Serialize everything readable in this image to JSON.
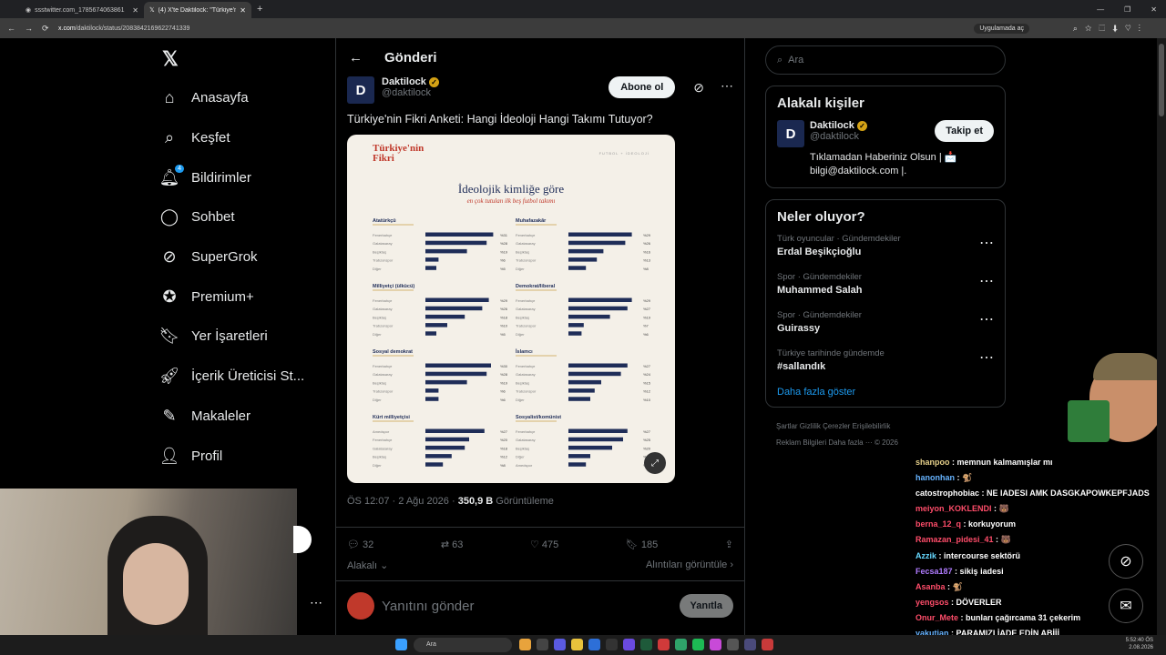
{
  "browser": {
    "tabs": [
      {
        "label": "ssstwitter.com_1785674063861"
      },
      {
        "label": "(4) X'te Daktilock: \"Türkiye'nin F"
      }
    ],
    "url_host": "x.com",
    "url_path": "/daktilock/status/2083842169622741339",
    "open_app": "Uygulamada aç"
  },
  "nav": {
    "items": [
      {
        "label": "Anasayfa",
        "icon": "home-icon"
      },
      {
        "label": "Keşfet",
        "icon": "search-icon"
      },
      {
        "label": "Bildirimler",
        "icon": "bell-icon",
        "badge": "4"
      },
      {
        "label": "Sohbet",
        "icon": "chat-icon"
      },
      {
        "label": "SuperGrok",
        "icon": "grok-icon"
      },
      {
        "label": "Premium+",
        "icon": "premium-icon"
      },
      {
        "label": "Yer İşaretleri",
        "icon": "bookmark-icon"
      },
      {
        "label": "İçerik Üreticisi St...",
        "icon": "rocket-icon"
      },
      {
        "label": "Makaleler",
        "icon": "article-icon"
      },
      {
        "label": "Profil",
        "icon": "person-icon"
      }
    ]
  },
  "post": {
    "header": "Gönderi",
    "author_name": "Daktilock",
    "author_handle": "@daktilock",
    "subscribe": "Abone ol",
    "text": "Türkiye'nin Fikri Anketi: Hangi İdeoloji Hangi Takımı Tutuyor?",
    "time": "ÖS 12:07 · 2 Ağu 2026 · ",
    "views": "350,9 B",
    "views_label": " Görüntüleme",
    "replies": "32",
    "reposts": "63",
    "likes": "475",
    "bookmarks": "185",
    "related": "Alakalı",
    "quotes": "Alıntıları görüntüle",
    "reply_placeholder": "Yanıtını gönder",
    "reply_button": "Yanıtla"
  },
  "infographic": {
    "brand_line1": "Türkiye'nin",
    "brand_line2": "Fikri",
    "top_right": "FUTBOL + İDEOLOJİ",
    "title": "İdeolojik kimliğe göre",
    "subtitle": "en çok tutulan ilk beş futbol takımı",
    "groups": [
      {
        "name": "Atatürkçü",
        "rows": [
          [
            "Fenerbahçe",
            31
          ],
          [
            "Galatasaray",
            28
          ],
          [
            "Beşiktaş",
            19
          ],
          [
            "Trabzonspor",
            6
          ],
          [
            "Diğer",
            5
          ]
        ]
      },
      {
        "name": "Muhafazakâr",
        "rows": [
          [
            "Fenerbahçe",
            29
          ],
          [
            "Galatasaray",
            26
          ],
          [
            "Beşiktaş",
            16
          ],
          [
            "Trabzonspor",
            13
          ],
          [
            "Diğer",
            8
          ]
        ]
      },
      {
        "name": "Milliyetçi (ülkücü)",
        "rows": [
          [
            "Fenerbahçe",
            29
          ],
          [
            "Galatasaray",
            26
          ],
          [
            "Beşiktaş",
            18
          ],
          [
            "Trabzonspor",
            10
          ],
          [
            "Diğer",
            5
          ]
        ]
      },
      {
        "name": "Demokrat/liberal",
        "rows": [
          [
            "Fenerbahçe",
            29
          ],
          [
            "Galatasaray",
            27
          ],
          [
            "Beşiktaş",
            19
          ],
          [
            "Trabzonspor",
            7
          ],
          [
            "Diğer",
            6
          ]
        ]
      },
      {
        "name": "Sosyal demokrat",
        "rows": [
          [
            "Fenerbahçe",
            30
          ],
          [
            "Galatasaray",
            28
          ],
          [
            "Beşiktaş",
            19
          ],
          [
            "Trabzonspor",
            6
          ],
          [
            "Diğer",
            6
          ]
        ]
      },
      {
        "name": "İslamcı",
        "rows": [
          [
            "Fenerbahçe",
            27
          ],
          [
            "Galatasaray",
            24
          ],
          [
            "Beşiktaş",
            15
          ],
          [
            "Trabzonspor",
            12
          ],
          [
            "Diğer",
            10
          ]
        ]
      },
      {
        "name": "Kürt milliyetçisi",
        "rows": [
          [
            "Amedspor",
            27
          ],
          [
            "Fenerbahçe",
            20
          ],
          [
            "Galatasaray",
            18
          ],
          [
            "Beşiktaş",
            12
          ],
          [
            "Diğer",
            8
          ]
        ]
      },
      {
        "name": "Sosyalist/komünist",
        "rows": [
          [
            "Fenerbahçe",
            27
          ],
          [
            "Galatasaray",
            25
          ],
          [
            "Beşiktaş",
            20
          ],
          [
            "Diğer",
            10
          ],
          [
            "Amedspor",
            8
          ]
        ]
      }
    ]
  },
  "sidebar": {
    "search_placeholder": "Ara",
    "people_title": "Alakalı kişiler",
    "person": {
      "name": "Daktilock",
      "handle": "@daktilock",
      "follow": "Takip et",
      "bio": "Tıklamadan Haberiniz Olsun | 📩 bilgi@daktilock.com |."
    },
    "trends_title": "Neler oluyor?",
    "trends": [
      {
        "cat": "Türk oyuncular · Gündemdekiler",
        "title": "Erdal Beşikçioğlu"
      },
      {
        "cat": "Spor · Gündemdekiler",
        "title": "Muhammed Salah"
      },
      {
        "cat": "Spor · Gündemdekiler",
        "title": "Guirassy"
      },
      {
        "cat": "Türkiye tarihinde gündemde",
        "title": "#sallandık"
      }
    ],
    "show_more": "Daha fazla göster",
    "footer1": "Şartlar    Gizlilik    Çerezler    Erişilebilirlik",
    "footer2": "Reklam Bilgileri    Daha fazla ···    © 2026"
  },
  "chat": [
    {
      "user": "shanpoo",
      "msg": "memnun kalmamışlar mı",
      "color": "#e6d08a"
    },
    {
      "user": "hanonhan",
      "msg": "🐒",
      "color": "#66b3ff"
    },
    {
      "user": "catostrophobiac",
      "msg": "NE IADESI AMK DASGKAPOWKEPFJADS",
      "color": "#ffffff"
    },
    {
      "user": "meiyon_KOKLENDI",
      "msg": "🐻",
      "color": "#ff4d6a"
    },
    {
      "user": "berna_12_q",
      "msg": "korkuyorum",
      "color": "#ff4d6a"
    },
    {
      "user": "Ramazan_pidesi_41",
      "msg": "🐻",
      "color": "#ff4d6a"
    },
    {
      "user": "Azzik",
      "msg": "intercourse sektörü",
      "color": "#66d9ff"
    },
    {
      "user": "Fecsa187",
      "msg": "sikiş iadesi",
      "color": "#b07cff"
    },
    {
      "user": "Asanba",
      "msg": "🐒",
      "color": "#ff4d6a"
    },
    {
      "user": "yengsos",
      "msg": "DÖVERLER",
      "color": "#ff4d6a"
    },
    {
      "user": "Onur_Mete",
      "msg": "bunları çağırcama 31 çekerim",
      "color": "#ff4d6a"
    },
    {
      "user": "yakutian",
      "msg": "PARAMIZI İADE EDİN ABİİİ",
      "color": "#66b3ff"
    }
  ],
  "taskbar": {
    "search": "Ara",
    "time": "5:52:40 ÖS",
    "date": "2.08.2026"
  }
}
